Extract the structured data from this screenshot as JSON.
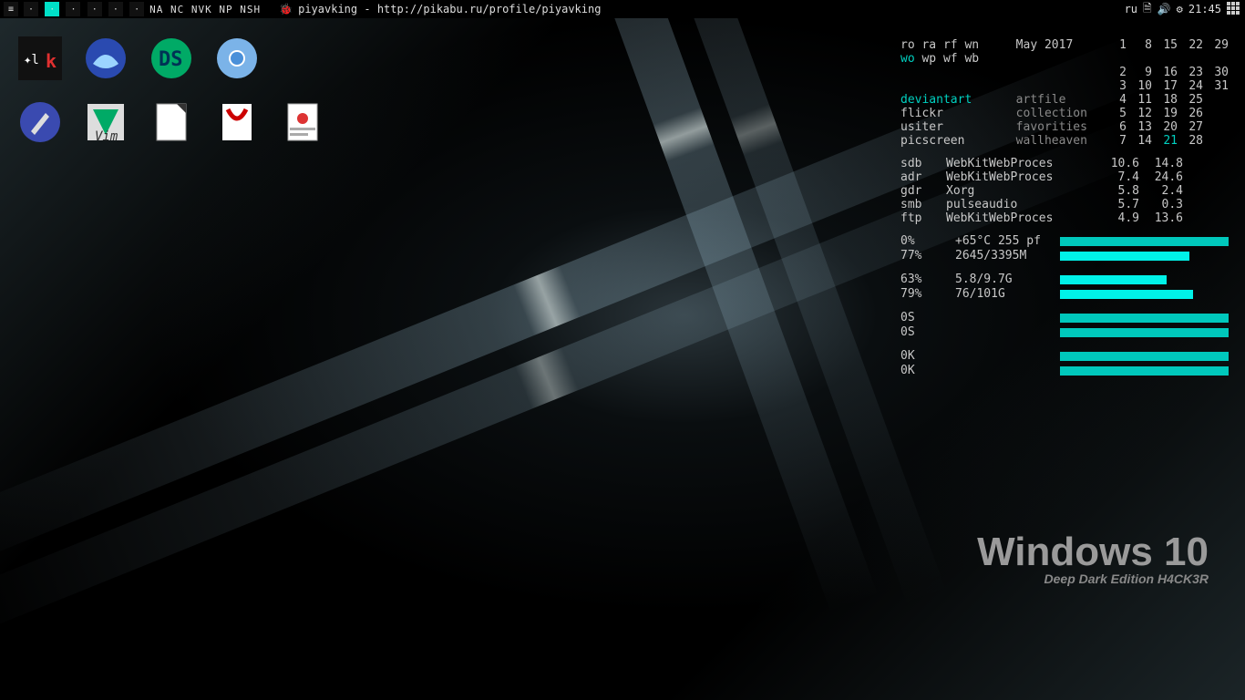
{
  "panel": {
    "workspaces": [
      "1",
      "2",
      "3",
      "4",
      "5",
      "6"
    ],
    "active_ws": 1,
    "indicators": "NA NC NVK NP NSH",
    "window_title_user": "piyavking",
    "window_title_sep": " - ",
    "window_title_url": "http://pikabu.ru/profile/piyavking",
    "layout": "ru",
    "clock": "21:45"
  },
  "desktop_icons": [
    {
      "name": "latex-lk"
    },
    {
      "name": "seamonkey"
    },
    {
      "name": "ds-app"
    },
    {
      "name": "chromium"
    },
    {
      "name": "scribus"
    },
    {
      "name": "gvim"
    },
    {
      "name": "libreoffice"
    },
    {
      "name": "master-pdf"
    },
    {
      "name": "evince"
    }
  ],
  "conky": {
    "header_row1": [
      "ro",
      "ra",
      "rf",
      "wn"
    ],
    "header_row2": [
      "wo",
      "wp",
      "wf",
      "wb"
    ],
    "month": "May 2017",
    "calendar": [
      [
        "1",
        "8",
        "15",
        "22",
        "29"
      ],
      [
        "2",
        "9",
        "16",
        "23",
        "30"
      ],
      [
        "3",
        "10",
        "17",
        "24",
        "31"
      ],
      [
        "4",
        "11",
        "18",
        "25",
        ""
      ],
      [
        "5",
        "12",
        "19",
        "26",
        ""
      ],
      [
        "6",
        "13",
        "20",
        "27",
        ""
      ],
      [
        "7",
        "14",
        "21",
        "28",
        ""
      ]
    ],
    "links": [
      {
        "a": "deviantart",
        "b": "artfile",
        "hi": true
      },
      {
        "a": "flickr",
        "b": "collection",
        "hi": false
      },
      {
        "a": "usiter",
        "b": "favorities",
        "hi": false
      },
      {
        "a": "picscreen",
        "b": "wallheaven",
        "hi": false
      }
    ],
    "processes": [
      {
        "dev": "sdb",
        "name": "WebKitWebProces",
        "cpu": "10.6",
        "mem": "14.8"
      },
      {
        "dev": "adr",
        "name": "WebKitWebProces",
        "cpu": "7.4",
        "mem": "24.6"
      },
      {
        "dev": "gdr",
        "name": "Xorg",
        "cpu": "5.8",
        "mem": "2.4"
      },
      {
        "dev": "smb",
        "name": "pulseaudio",
        "cpu": "5.7",
        "mem": "0.3"
      },
      {
        "dev": "ftp",
        "name": "WebKitWebProces",
        "cpu": "4.9",
        "mem": "13.6"
      }
    ],
    "bars1": [
      {
        "pct": "0%",
        "info": "+65°C 255 pf",
        "fill": 100,
        "bright": false
      },
      {
        "pct": "77%",
        "info": "2645/3395M",
        "fill": 77,
        "bright": true
      }
    ],
    "bars_disk": [
      {
        "pct": "63%",
        "info": "5.8/9.7G",
        "fill": 63,
        "bright": true
      },
      {
        "pct": "79%",
        "info": "76/101G",
        "fill": 79,
        "bright": true
      }
    ],
    "net": [
      {
        "v": "0S",
        "fill": 100
      },
      {
        "v": "0S",
        "fill": 100
      }
    ],
    "net2": [
      {
        "v": "0K",
        "fill": 100
      },
      {
        "v": "0K",
        "fill": 100
      }
    ]
  },
  "watermark": {
    "title": "Windows 10",
    "subtitle": "Deep Dark Edition H4CK3R"
  }
}
